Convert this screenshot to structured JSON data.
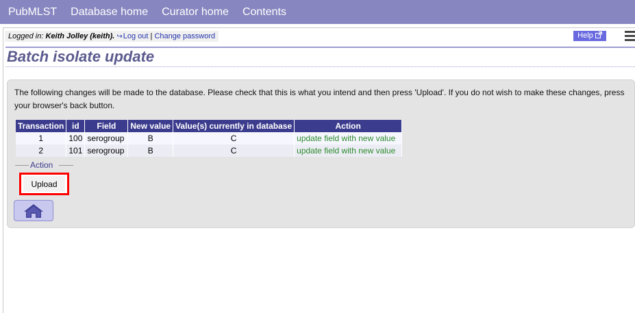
{
  "nav": {
    "items": [
      "PubMLST",
      "Database home",
      "Curator home",
      "Contents"
    ]
  },
  "login": {
    "prefix": "Logged in:",
    "user": "Keith Jolley (keith).",
    "logout": "Log out",
    "sep": "|",
    "change_password": "Change password"
  },
  "help": {
    "label": "Help"
  },
  "page": {
    "title": "Batch isolate update"
  },
  "message": "The following changes will be made to the database. Please check that this is what you intend and then press 'Upload'. If you do not wish to make these changes, press your browser's back button.",
  "table": {
    "headers": [
      "Transaction",
      "id",
      "Field",
      "New value",
      "Value(s) currently in database",
      "Action"
    ],
    "rows": [
      {
        "transaction": "1",
        "id": "100",
        "field": "serogroup",
        "new_value": "B",
        "current": "C",
        "action": "update field with new value"
      },
      {
        "transaction": "2",
        "id": "101",
        "field": "serogroup",
        "new_value": "B",
        "current": "C",
        "action": "update field with new value"
      }
    ]
  },
  "action_fieldset": {
    "legend": "Action"
  },
  "buttons": {
    "upload": "Upload"
  },
  "colors": {
    "nav_bg": "#8786c0",
    "header_bg": "#3c3c8e",
    "action_text": "#2b8a2b",
    "highlight": "#ff0000"
  }
}
